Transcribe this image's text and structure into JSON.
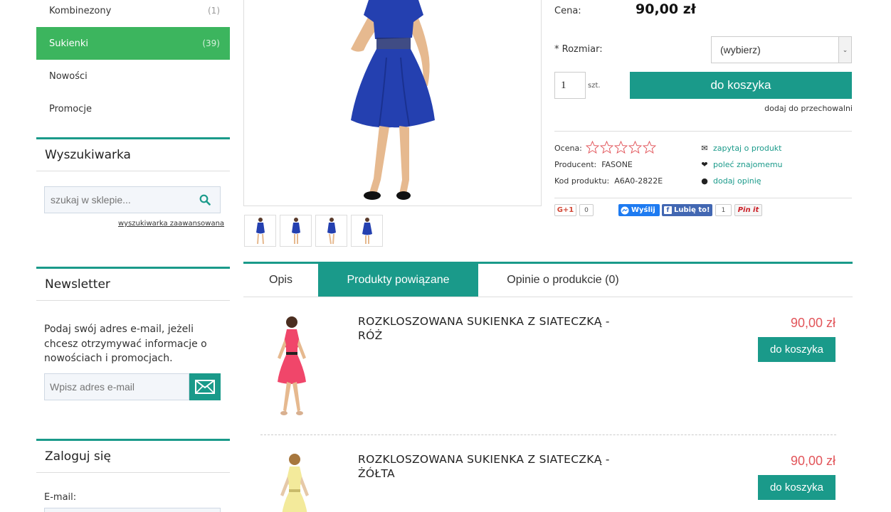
{
  "sidebar": {
    "categories": [
      {
        "label": "Kombinezony",
        "count": "(1)"
      },
      {
        "label": "Sukienki",
        "count": "(39)"
      },
      {
        "label": "Nowości",
        "count": ""
      },
      {
        "label": "Promocje",
        "count": ""
      }
    ],
    "search": {
      "title": "Wyszukiwarka",
      "placeholder": "szukaj w sklepie...",
      "advanced_link": "wyszukiwarka zaawansowana"
    },
    "newsletter": {
      "title": "Newsletter",
      "text": "Podaj swój adres e-mail, jeżeli chcesz otrzymywać informacje o nowościach i promocjach.",
      "placeholder": "Wpisz adres e-mail"
    },
    "login": {
      "title": "Zaloguj się",
      "email_label": "E-mail:"
    }
  },
  "product": {
    "price_label": "Cena:",
    "price": "90,00 zł",
    "size_label": "* Rozmiar:",
    "size_selected": "(wybierz)",
    "qty_value": "1",
    "qty_unit": "szt.",
    "add_to_cart": "do koszyka",
    "storage_link": "dodaj do przechowalni",
    "rating_label": "Ocena:",
    "rating": 0,
    "producer_label": "Producent:",
    "producer": "FASONE",
    "code_label": "Kod produktu:",
    "code": "A6A0-2822E",
    "links": {
      "ask": "zapytaj o produkt",
      "recommend": "poleć znajomemu",
      "review": "dodaj opinię"
    },
    "social": {
      "gplus": "G+1",
      "gplus_count": "0",
      "messenger": "Wyślij",
      "fb_like": "Lubię to!",
      "fb_count": "1",
      "pinterest": "Pin it"
    }
  },
  "tabs": [
    {
      "label": "Opis"
    },
    {
      "label": "Produkty powiązane"
    },
    {
      "label": "Opinie o produkcie (0)"
    }
  ],
  "related": [
    {
      "title": "ROZKLOSZOWANA SUKIENKA Z SIATECZKĄ - RÓŻ",
      "price": "90,00 zł",
      "button": "do koszyka",
      "color": "#f0466a"
    },
    {
      "title": "ROZKLOSZOWANA SUKIENKA Z SIATECZKĄ - ŻÓŁTA",
      "price": "90,00 zł",
      "button": "do koszyka",
      "color": "#f3ea9b"
    }
  ],
  "colors": {
    "accent": "#1a9a8a",
    "active_category": "#3cb55e",
    "price_red": "#e2555a",
    "dress_blue": "#2440b0"
  }
}
